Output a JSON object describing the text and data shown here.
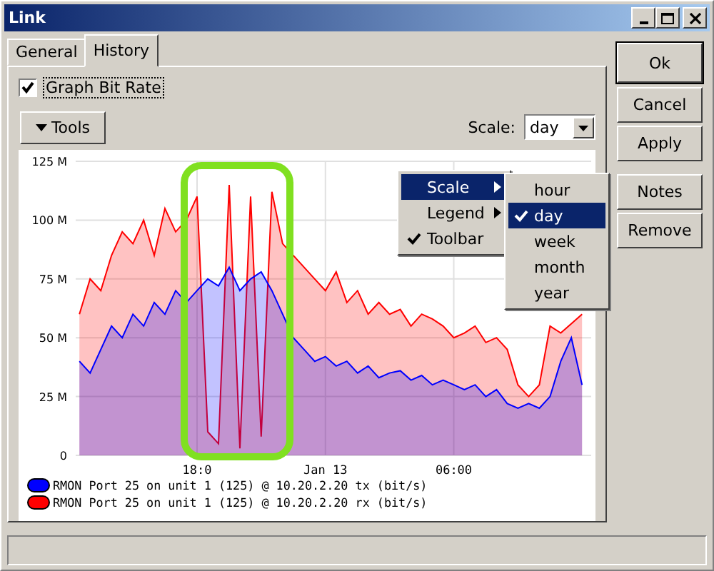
{
  "window": {
    "title": "Link"
  },
  "tabs": [
    {
      "label": "General",
      "selected": false
    },
    {
      "label": "History",
      "selected": true
    }
  ],
  "graph_bit_rate": {
    "label": "Graph Bit Rate",
    "checked": true
  },
  "tools_button": {
    "label": "Tools"
  },
  "scale": {
    "label": "Scale:",
    "value": "day"
  },
  "chart": {
    "chart_data": {
      "type": "area",
      "grid": true,
      "legend": "bottom",
      "ylim": [
        0,
        125
      ],
      "categories": [
        null,
        null,
        null,
        null,
        null,
        null,
        null,
        null,
        null,
        null,
        null,
        "18:0",
        null,
        null,
        null,
        null,
        null,
        null,
        null,
        null,
        null,
        null,
        null,
        "Jan 13",
        null,
        null,
        null,
        null,
        null,
        null,
        null,
        null,
        null,
        null,
        null,
        "06:00",
        null,
        null,
        null,
        null,
        null,
        null,
        null,
        null,
        null,
        null,
        null,
        null
      ],
      "series": [
        {
          "name": "RMON Port 25 on unit 1 (125) @ 10.20.2.20 tx (bit/s)",
          "color": "#0000ff",
          "values": [
            40,
            35,
            45,
            55,
            50,
            60,
            55,
            65,
            60,
            70,
            65,
            70,
            75,
            72,
            80,
            70,
            75,
            78,
            70,
            60,
            50,
            45,
            40,
            42,
            38,
            40,
            35,
            38,
            33,
            35,
            36,
            32,
            34,
            30,
            32,
            30,
            28,
            30,
            25,
            28,
            22,
            20,
            22,
            20,
            25,
            40,
            50,
            30
          ]
        },
        {
          "name": "RMON Port 25 on unit 1 (125) @ 10.20.2.20 rx (bit/s)",
          "color": "#ff0000",
          "values": [
            60,
            75,
            70,
            85,
            95,
            90,
            100,
            85,
            105,
            95,
            100,
            110,
            10,
            5,
            115,
            3,
            110,
            8,
            112,
            90,
            85,
            80,
            75,
            70,
            78,
            65,
            70,
            60,
            65,
            60,
            62,
            55,
            60,
            58,
            55,
            50,
            52,
            55,
            48,
            50,
            45,
            30,
            25,
            30,
            55,
            52,
            56,
            60
          ]
        }
      ],
      "yticks": [
        {
          "value": 0,
          "label": "0"
        },
        {
          "value": 25,
          "label": "25 M"
        },
        {
          "value": 50,
          "label": "50 M"
        },
        {
          "value": 75,
          "label": "75 M"
        },
        {
          "value": 100,
          "label": "100 M"
        },
        {
          "value": 125,
          "label": "125 M"
        }
      ]
    }
  },
  "context_menu": {
    "items": [
      {
        "label": "Scale",
        "kind": "submenu",
        "selected": true,
        "checked": false
      },
      {
        "label": "Legend",
        "kind": "submenu",
        "selected": false,
        "checked": false
      },
      {
        "label": "Toolbar",
        "kind": "toggle",
        "selected": false,
        "checked": true
      }
    ]
  },
  "scale_submenu": {
    "items": [
      {
        "label": "hour",
        "selected": false,
        "checked": false
      },
      {
        "label": "day",
        "selected": true,
        "checked": true
      },
      {
        "label": "week",
        "selected": false,
        "checked": false
      },
      {
        "label": "month",
        "selected": false,
        "checked": false
      },
      {
        "label": "year",
        "selected": false,
        "checked": false
      }
    ]
  },
  "buttons": [
    "Ok",
    "Cancel",
    "Apply"
  ],
  "extra_buttons": [
    "Notes",
    "Remove"
  ]
}
